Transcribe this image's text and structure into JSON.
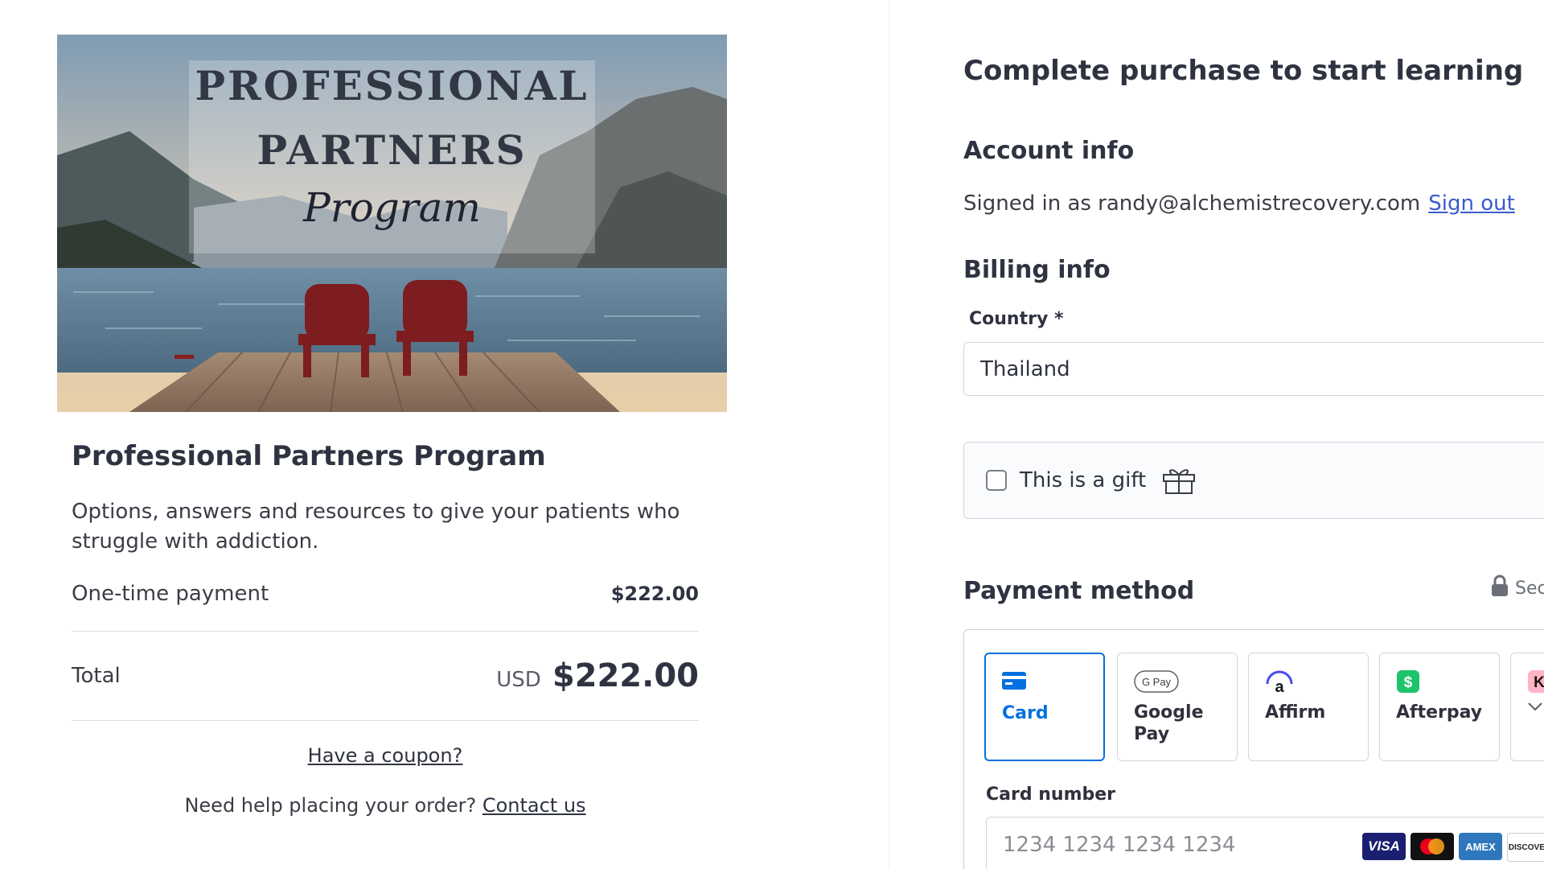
{
  "banner": {
    "title_line1": "PROFESSIONAL",
    "title_line2": "PARTNERS",
    "title_script": "Program"
  },
  "product": {
    "title": "Professional Partners Program",
    "description": "Options, answers and resources to give your patients who struggle with addiction.",
    "onetime_label": "One-time payment",
    "onetime_value": "$222.00",
    "total_label": "Total",
    "total_currency": "USD",
    "total_value": "$222.00",
    "coupon_link": "Have a coupon?",
    "help_text": "Need help placing your order?",
    "help_link": "Contact us"
  },
  "checkout": {
    "title": "Complete purchase to start learning",
    "account_heading": "Account info",
    "signed_in_text": "Signed in as randy@alchemistrecovery.com",
    "sign_out": "Sign out",
    "billing_heading": "Billing info",
    "country_label": "Country *",
    "country_value": "Thailand",
    "gift_label": "This is a gift",
    "payment_heading": "Payment method",
    "secure_text": "Sec",
    "tabs": [
      {
        "label": "Card",
        "icon": "credit-card-icon"
      },
      {
        "label": "Google Pay",
        "icon": "google-pay-icon",
        "icon_text": "G Pay"
      },
      {
        "label": "Affirm",
        "icon": "affirm-icon",
        "icon_text": "a"
      },
      {
        "label": "Afterpay",
        "icon": "afterpay-icon",
        "icon_text": "$"
      },
      {
        "label": "",
        "icon": "klarna-icon",
        "icon_text": "K"
      }
    ],
    "card_number_label": "Card number",
    "card_number_placeholder": "1234 1234 1234 1234",
    "card_brands": [
      "VISA",
      "",
      "AMEX",
      "DISCOVER"
    ]
  },
  "colors": {
    "accent": "#0570de",
    "link": "#3a5ccc",
    "text": "#2f3341",
    "afterpay": "#1ec36b",
    "klarna": "#ffb3c7",
    "visa": "#1a1f71",
    "amex": "#2e77bc"
  }
}
